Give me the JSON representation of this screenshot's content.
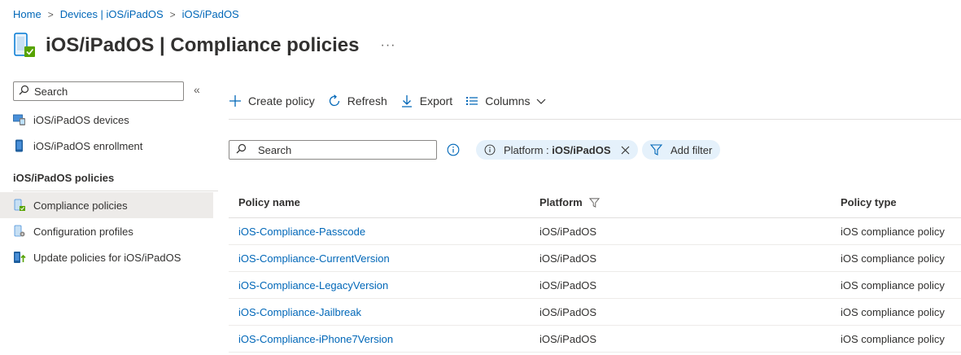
{
  "breadcrumb": {
    "items": [
      "Home",
      "Devices | iOS/iPadOS",
      "iOS/iPadOS"
    ]
  },
  "header": {
    "title_strong": "iOS/iPadOS",
    "title_rest": " | Compliance policies",
    "more": "···"
  },
  "sidebar": {
    "search_placeholder": "Search",
    "collapse": "«",
    "items": [
      {
        "label": "iOS/iPadOS devices",
        "icon": "devices-icon"
      },
      {
        "label": "iOS/iPadOS enrollment",
        "icon": "phone-icon"
      }
    ],
    "section_title": "iOS/iPadOS policies",
    "policy_items": [
      {
        "label": "Compliance policies",
        "icon": "compliance-icon",
        "selected": true
      },
      {
        "label": "Configuration profiles",
        "icon": "config-profile-icon",
        "selected": false
      },
      {
        "label": "Update policies for iOS/iPadOS",
        "icon": "update-icon",
        "selected": false
      }
    ]
  },
  "toolbar": {
    "create_label": "Create policy",
    "refresh_label": "Refresh",
    "export_label": "Export",
    "columns_label": "Columns"
  },
  "filters": {
    "search_placeholder": "Search",
    "platform_prefix": "Platform : ",
    "platform_value": "iOS/iPadOS",
    "add_filter_label": "Add filter"
  },
  "table": {
    "headers": [
      "Policy name",
      "Platform",
      "Policy type"
    ],
    "rows": [
      {
        "name": "iOS-Compliance-Passcode",
        "platform": "iOS/iPadOS",
        "type": "iOS compliance policy"
      },
      {
        "name": "iOS-Compliance-CurrentVersion",
        "platform": "iOS/iPadOS",
        "type": "iOS compliance policy"
      },
      {
        "name": "iOS-Compliance-LegacyVersion",
        "platform": "iOS/iPadOS",
        "type": "iOS compliance policy"
      },
      {
        "name": "iOS-Compliance-Jailbreak",
        "platform": "iOS/iPadOS",
        "type": "iOS compliance policy"
      },
      {
        "name": "iOS-Compliance-iPhone7Version",
        "platform": "iOS/iPadOS",
        "type": "iOS compliance policy"
      }
    ]
  },
  "colors": {
    "accent": "#0067b8",
    "selected_bg": "#edebe9",
    "pill_bg": "#e5f1fb",
    "check_green": "#57a300"
  }
}
